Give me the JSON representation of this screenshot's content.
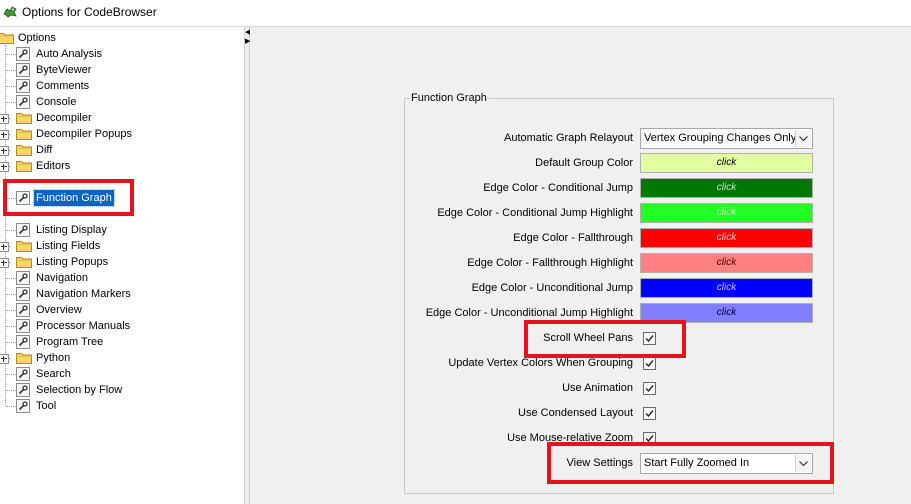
{
  "window": {
    "title": "Options for CodeBrowser"
  },
  "tree": {
    "root": "Options",
    "items": [
      {
        "label": "Auto Analysis",
        "kind": "leaf"
      },
      {
        "label": "ByteViewer",
        "kind": "leaf"
      },
      {
        "label": "Comments",
        "kind": "leaf"
      },
      {
        "label": "Console",
        "kind": "leaf"
      },
      {
        "label": "Decompiler",
        "kind": "folder"
      },
      {
        "label": "Decompiler Popups",
        "kind": "folder"
      },
      {
        "label": "Diff",
        "kind": "folder"
      },
      {
        "label": "Editors",
        "kind": "folder"
      },
      {
        "label": "",
        "kind": "hidden"
      },
      {
        "label": "Function Graph",
        "kind": "leaf",
        "selected": true
      },
      {
        "label": "",
        "kind": "hidden"
      },
      {
        "label": "Listing Display",
        "kind": "leaf"
      },
      {
        "label": "Listing Fields",
        "kind": "folder"
      },
      {
        "label": "Listing Popups",
        "kind": "folder"
      },
      {
        "label": "Navigation",
        "kind": "leaf"
      },
      {
        "label": "Navigation Markers",
        "kind": "leaf"
      },
      {
        "label": "Overview",
        "kind": "leaf"
      },
      {
        "label": "Processor Manuals",
        "kind": "leaf"
      },
      {
        "label": "Program Tree",
        "kind": "leaf"
      },
      {
        "label": "Python",
        "kind": "folder"
      },
      {
        "label": "Search",
        "kind": "leaf"
      },
      {
        "label": "Selection by Flow",
        "kind": "leaf"
      },
      {
        "label": "Tool",
        "kind": "leaf"
      }
    ]
  },
  "panel": {
    "group_title": "Function Graph",
    "options": [
      {
        "label": "Automatic Graph Relayout",
        "type": "combo",
        "value": "Vertex Grouping Changes Only"
      },
      {
        "label": "Default Group Color",
        "type": "color",
        "value": "click",
        "color": "#e3ffa0",
        "text_color": "#000000"
      },
      {
        "label": "Edge Color - Conditional Jump",
        "type": "color",
        "value": "click",
        "color": "#007800",
        "text_color": "#c8e6c8"
      },
      {
        "label": "Edge Color - Conditional Jump Highlight",
        "type": "color",
        "value": "click",
        "color": "#23ff23",
        "text_color": "#c0ffc0"
      },
      {
        "label": "Edge Color - Fallthrough",
        "type": "color",
        "value": "click",
        "color": "#ff0000",
        "text_color": "#ffd0d0"
      },
      {
        "label": "Edge Color - Fallthrough Highlight",
        "type": "color",
        "value": "click",
        "color": "#ff8080",
        "text_color": "#400000"
      },
      {
        "label": "Edge Color - Unconditional Jump",
        "type": "color",
        "value": "click",
        "color": "#0000ff",
        "text_color": "#c8c8ff"
      },
      {
        "label": "Edge Color - Unconditional Jump Highlight",
        "type": "color",
        "value": "click",
        "color": "#8080ff",
        "text_color": "#000040"
      },
      {
        "label": "Scroll Wheel Pans",
        "type": "checkbox",
        "checked": true
      },
      {
        "label": "Update Vertex Colors When Grouping",
        "type": "checkbox",
        "checked": true
      },
      {
        "label": "Use Animation",
        "type": "checkbox",
        "checked": true
      },
      {
        "label": "Use Condensed Layout",
        "type": "checkbox",
        "checked": true
      },
      {
        "label": "Use Mouse-relative Zoom",
        "type": "checkbox",
        "checked": true
      },
      {
        "label": "View Settings",
        "type": "combo",
        "value": "Start Fully Zoomed In"
      }
    ]
  },
  "highlight_color": "#e4141f"
}
